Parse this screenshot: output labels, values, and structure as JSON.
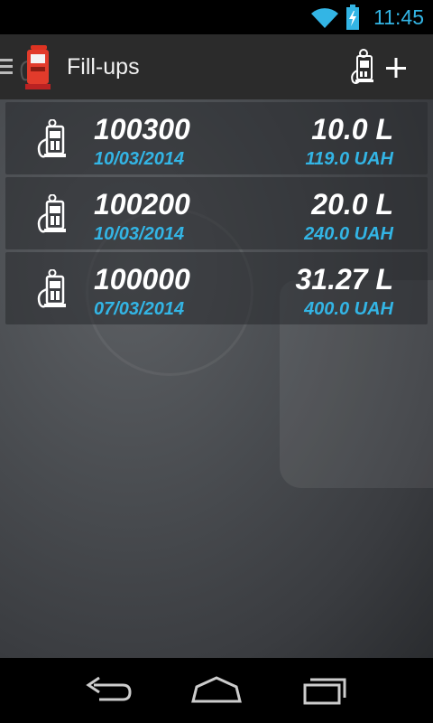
{
  "status_bar": {
    "time": "11:45"
  },
  "action_bar": {
    "title": "Fill-ups"
  },
  "fillups": [
    {
      "odometer": "100300",
      "date": "10/03/2014",
      "volume": "10.0 L",
      "cost": "119.0  UAH"
    },
    {
      "odometer": "100200",
      "date": "10/03/2014",
      "volume": "20.0 L",
      "cost": "240.0  UAH"
    },
    {
      "odometer": "100000",
      "date": "07/03/2014",
      "volume": "31.27 L",
      "cost": "400.0  UAH"
    }
  ],
  "colors": {
    "accent": "#33b5e5",
    "action_bar": "#2b2b2b",
    "row_text": "#ffffff"
  },
  "icons": [
    "wifi-icon",
    "battery-icon",
    "drawer-icon",
    "gas-pump-icon",
    "add-fillup-icon",
    "back-icon",
    "home-icon",
    "recent-apps-icon"
  ]
}
